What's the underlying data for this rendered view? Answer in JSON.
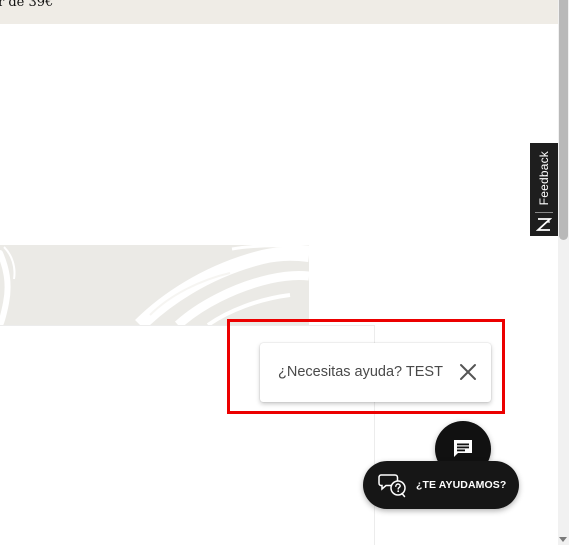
{
  "promo_banner": {
    "text": "r de 39€"
  },
  "feedback_tab": {
    "label": "Feedback"
  },
  "help_popup": {
    "text": "¿Necesitas ayuda? TEST",
    "close_icon": "close-icon"
  },
  "chat_button": {
    "icon": "chat-bubble-icon"
  },
  "help_pill": {
    "label": "¿TE AYUDAMOS?",
    "icon": "question-chat-icon"
  },
  "colors": {
    "banner_bg": "#efece6",
    "feedback_bg": "#1e1e1e",
    "highlight": "#ec0000",
    "fab_bg": "#111111"
  }
}
